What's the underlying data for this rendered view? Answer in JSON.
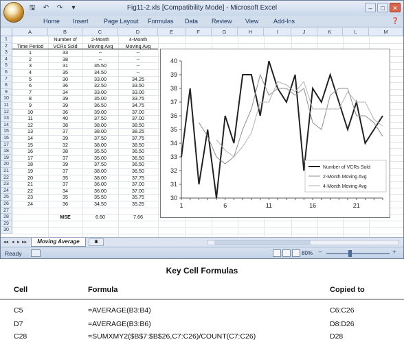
{
  "window": {
    "title": "Fig11-2.xls  [Compatibility Mode] - Microsoft Excel",
    "qat_icons": [
      "save-icon",
      "undo-icon",
      "redo-icon",
      "customize-icon"
    ]
  },
  "ribbon": {
    "tabs": [
      "Home",
      "Insert",
      "Page Layout",
      "Formulas",
      "Data",
      "Review",
      "View",
      "Add-Ins"
    ]
  },
  "columns": [
    "A",
    "B",
    "C",
    "D",
    "E",
    "F",
    "G",
    "H",
    "I",
    "J",
    "K",
    "L",
    "M"
  ],
  "rows": [
    "1",
    "2",
    "3",
    "4",
    "5",
    "6",
    "7",
    "8",
    "9",
    "10",
    "11",
    "12",
    "13",
    "14",
    "15",
    "16",
    "17",
    "18",
    "19",
    "20",
    "21",
    "22",
    "23",
    "24",
    "25",
    "26",
    "27",
    "28",
    "29",
    "30"
  ],
  "sheet": {
    "header_row1": {
      "b": "Number of",
      "c": "2-Month",
      "d": "4-Month"
    },
    "header_row2": {
      "a": "Time Period",
      "b": "VCRs Sold",
      "c": "Moving Avg",
      "d": "Moving Avg"
    },
    "data": [
      [
        "1",
        "33",
        "--",
        "--"
      ],
      [
        "2",
        "38",
        "--",
        "--"
      ],
      [
        "3",
        "31",
        "35.50",
        "--"
      ],
      [
        "4",
        "35",
        "34.50",
        "--"
      ],
      [
        "5",
        "30",
        "33.00",
        "34.25"
      ],
      [
        "6",
        "36",
        "32.50",
        "33.50"
      ],
      [
        "7",
        "34",
        "33.00",
        "33.00"
      ],
      [
        "8",
        "39",
        "35.00",
        "33.75"
      ],
      [
        "9",
        "39",
        "36.50",
        "34.75"
      ],
      [
        "10",
        "36",
        "39.00",
        "37.00"
      ],
      [
        "11",
        "40",
        "37.50",
        "37.00"
      ],
      [
        "12",
        "38",
        "38.00",
        "38.50"
      ],
      [
        "13",
        "37",
        "38.00",
        "38.25"
      ],
      [
        "14",
        "39",
        "37.50",
        "37.75"
      ],
      [
        "15",
        "32",
        "38.00",
        "38.50"
      ],
      [
        "16",
        "38",
        "35.50",
        "36.50"
      ],
      [
        "17",
        "37",
        "35.00",
        "36.50"
      ],
      [
        "18",
        "39",
        "37.50",
        "36.50"
      ],
      [
        "19",
        "37",
        "38.00",
        "36.50"
      ],
      [
        "20",
        "35",
        "38.00",
        "37.75"
      ],
      [
        "21",
        "37",
        "36.00",
        "37.00"
      ],
      [
        "22",
        "34",
        "36.00",
        "37.00"
      ],
      [
        "23",
        "35",
        "35.50",
        "35.75"
      ],
      [
        "24",
        "36",
        "34.50",
        "35.25"
      ]
    ],
    "mse": {
      "label": "MSE",
      "c": "6.60",
      "d": "7.66"
    },
    "sheet_tab": "Moving Average"
  },
  "chart_data": {
    "type": "line",
    "title": "",
    "xlabel": "",
    "ylabel": "",
    "x": [
      1,
      2,
      3,
      4,
      5,
      6,
      7,
      8,
      9,
      10,
      11,
      12,
      13,
      14,
      15,
      16,
      17,
      18,
      19,
      20,
      21,
      22,
      23,
      24
    ],
    "x_ticks": [
      "1",
      "6",
      "11",
      "16",
      "21"
    ],
    "y_ticks": [
      "30",
      "31",
      "32",
      "33",
      "34",
      "35",
      "36",
      "37",
      "38",
      "39",
      "40"
    ],
    "ylim": [
      30,
      40
    ],
    "legend_position": "bottom-right",
    "grid": false,
    "series": [
      {
        "name": "Number of VCRs Sold",
        "color": "#222222",
        "values": [
          33,
          38,
          31,
          35,
          30,
          36,
          34,
          39,
          39,
          36,
          40,
          38,
          37,
          39,
          32,
          38,
          37,
          39,
          37,
          35,
          37,
          34,
          35,
          36
        ]
      },
      {
        "name": "2-Month Moving Avg",
        "color": "#8c8c8c",
        "values": [
          null,
          null,
          35.5,
          34.5,
          33.0,
          32.5,
          33.0,
          35.0,
          36.5,
          39.0,
          37.5,
          38.0,
          38.0,
          37.5,
          38.0,
          35.5,
          35.0,
          37.5,
          38.0,
          38.0,
          36.0,
          36.0,
          35.5,
          34.5
        ]
      },
      {
        "name": "4-Month Moving Avg",
        "color": "#b3b3b3",
        "values": [
          null,
          null,
          null,
          null,
          34.25,
          33.5,
          33.0,
          33.75,
          34.75,
          37.0,
          37.0,
          38.5,
          38.25,
          37.75,
          38.5,
          36.5,
          36.5,
          36.5,
          36.5,
          37.75,
          37.0,
          37.0,
          35.75,
          35.25
        ]
      }
    ]
  },
  "statusbar": {
    "ready": "Ready",
    "zoom": "80%"
  },
  "key_formulas": {
    "title": "Key Cell Formulas",
    "headers": [
      "Cell",
      "Formula",
      "Copied to"
    ],
    "rows": [
      [
        "C5",
        "=AVERAGE(B3:B4)",
        "C6:C26"
      ],
      [
        "D7",
        "=AVERAGE(B3:B6)",
        "D8:D26"
      ],
      [
        "C28",
        "=SUMXMY2($B$7:$B$26,C7:C26)/COUNT(C7:C26)",
        "D28"
      ]
    ]
  }
}
